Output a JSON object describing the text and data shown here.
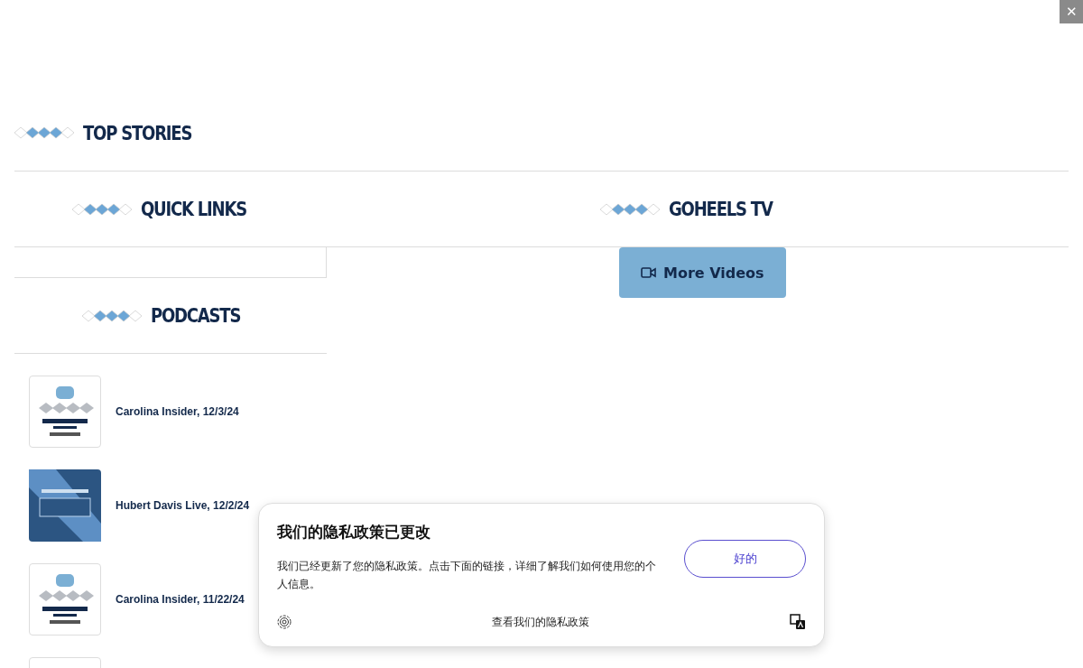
{
  "close_button": {
    "label": "✕"
  },
  "sections": {
    "top_stories": {
      "title": "TOP STORIES"
    },
    "quick_links": {
      "title": "QUICK LINKS"
    },
    "goheels_tv": {
      "title": "GOHEELS TV",
      "button": "More Videos"
    },
    "podcasts": {
      "title": "PODCASTS"
    }
  },
  "podcasts": [
    {
      "kind": "insider",
      "title": "Carolina Insider, 12/3/24"
    },
    {
      "kind": "live",
      "title": "Hubert Davis Live, 12/2/24"
    },
    {
      "kind": "insider",
      "title": "Carolina Insider, 11/22/24"
    }
  ],
  "privacy_notice": {
    "title": "我们的隐私政策已更改",
    "body": "我们已经更新了您的隐私政策。点击下面的链接，详细了解我们如何使用您的个人信息。",
    "ok_button": "好的",
    "link": "查看我们的隐私政策"
  }
}
